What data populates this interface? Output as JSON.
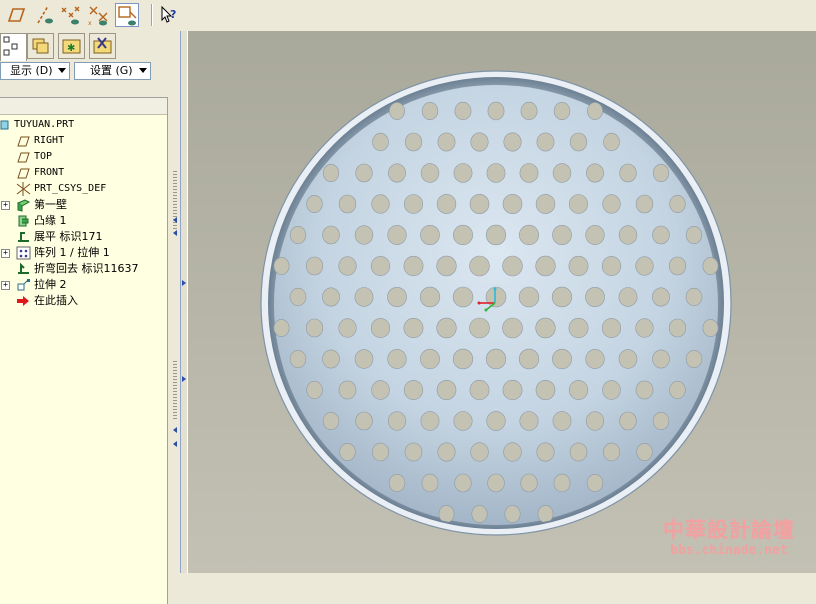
{
  "toolbar": {
    "icons": [
      "datum-plane-display-icon",
      "datum-axis-display-icon",
      "point-display-icon",
      "csys-display-icon",
      "annotation-display-icon",
      "context-help-icon"
    ]
  },
  "model_tree": {
    "tabs": [
      "model-tree-tab",
      "layer-tree-tab",
      "favorites-tab",
      "tools-tab"
    ],
    "show_menu": "显示 (D)",
    "settings_menu": "设置 (G)",
    "items": [
      {
        "label": "TUYUAN.PRT",
        "icon": "part-icon",
        "expandable": false
      },
      {
        "label": "RIGHT",
        "icon": "datum-plane-icon",
        "expandable": false
      },
      {
        "label": "TOP",
        "icon": "datum-plane-icon",
        "expandable": false
      },
      {
        "label": "FRONT",
        "icon": "datum-plane-icon",
        "expandable": false
      },
      {
        "label": "PRT_CSYS_DEF",
        "icon": "csys-icon",
        "expandable": false
      },
      {
        "label": "第一壁",
        "icon": "sheetmetal-wall-icon",
        "expandable": true
      },
      {
        "label": "凸缘 1",
        "icon": "flange-icon",
        "expandable": false
      },
      {
        "label": "展平 标识171",
        "icon": "unbend-icon",
        "expandable": false
      },
      {
        "label": "阵列 1 / 拉伸 1",
        "icon": "pattern-icon",
        "expandable": true
      },
      {
        "label": "折弯回去 标识11637",
        "icon": "bend-back-icon",
        "expandable": false
      },
      {
        "label": "拉伸 2",
        "icon": "extrude-icon",
        "expandable": true
      },
      {
        "label": "在此插入",
        "icon": "insert-here-arrow-icon",
        "expandable": false
      }
    ]
  },
  "viewport": {
    "model": "perforated-sheetmetal-dome",
    "colors": {
      "background": "#b6b5a8",
      "model": "#c8d8e6",
      "hole": "#c4c2b3",
      "csys_x": "#e0202a",
      "csys_y": "#2fb43a",
      "csys_z": "#2bbbd8"
    }
  },
  "watermark": {
    "title": "中華設計論壇",
    "url": "bbs.chinade.net"
  }
}
